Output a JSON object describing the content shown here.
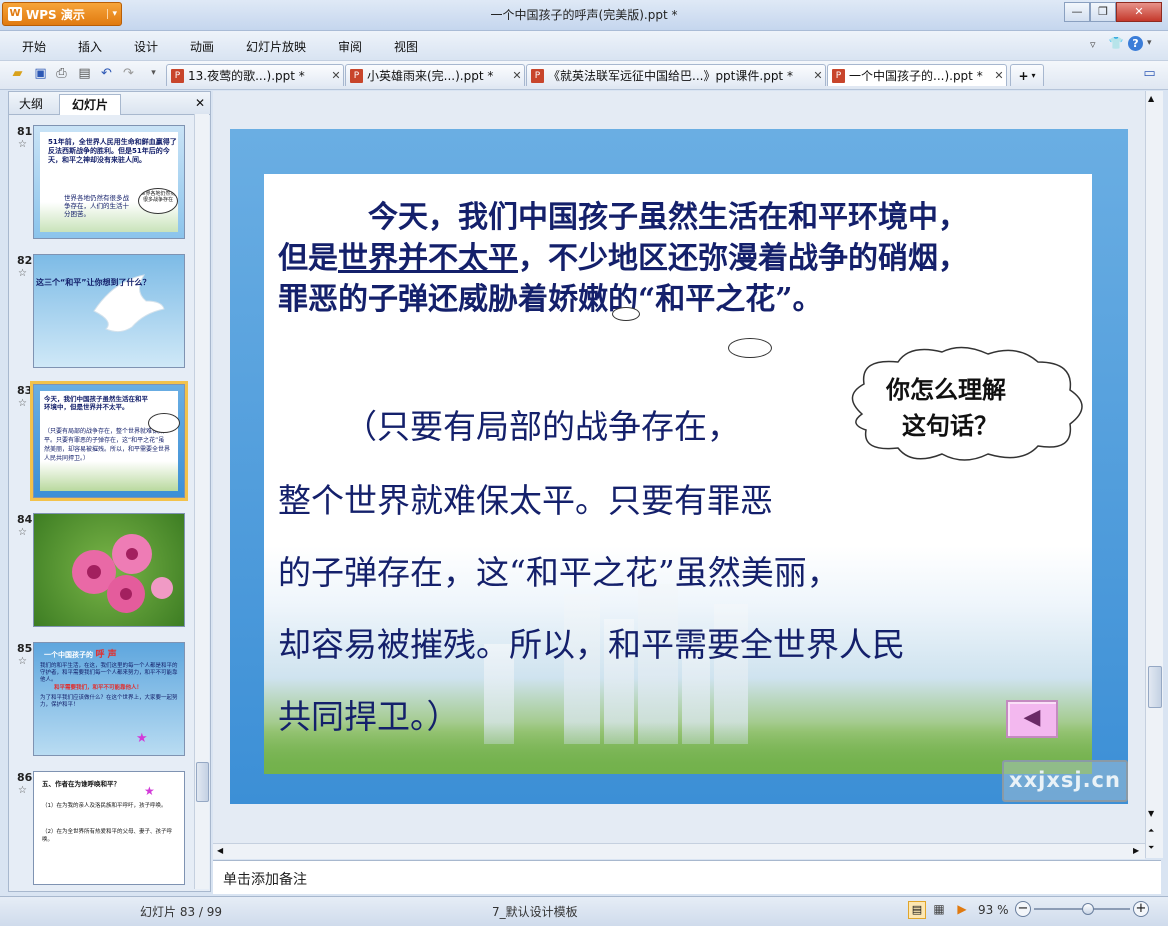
{
  "app": {
    "name": "WPS 演示",
    "caret": "▾",
    "title": "一个中国孩子的呼声(完美版).ppt *"
  },
  "window_controls": {
    "minimize": "—",
    "restore": "❐",
    "close": "✕"
  },
  "menu": [
    "开始",
    "插入",
    "设计",
    "动画",
    "幻灯片放映",
    "审阅",
    "视图"
  ],
  "doc_tabs": [
    {
      "label": "13.夜莺的歌...).ppt *"
    },
    {
      "label": "小英雄雨来(完...).ppt *"
    },
    {
      "label": "《就英法联军远征中国给巴...》ppt课件.ppt *"
    },
    {
      "label": "一个中国孩子的...).ppt *"
    }
  ],
  "tab_close": "✕",
  "tab_add": "+",
  "panel": {
    "tab_outline": "大纲",
    "tab_slides": "幻灯片",
    "close": "✕",
    "star": "☆"
  },
  "slides": [
    {
      "num": "81",
      "text": "51年前，全世界人民用生命和鲜血赢得了反法西斯战争的胜利。但是51年后的今天，和平之神却没有来驻人间。",
      "text2": "世界各地仍然有很多战争存在，人们的生活十分困苦。",
      "bubble": "世界各地仍然有很多战争存在"
    },
    {
      "num": "82",
      "text": "这三个“和平”让你想到了什么？"
    },
    {
      "num": "83",
      "text": "今天，我们中国孩子虽然生活在和平环境中，但是世界并不太平。",
      "text2": "（只要有局部的战争存在，整个世界就难保太平。只要有罪恶的子弹存在，这“和平之花”虽然美丽，却容易被摧残。所以，和平需要全世界人民共同捍卫。）"
    },
    {
      "num": "84"
    },
    {
      "num": "85",
      "title_a": "一个中国孩子的",
      "title_b": "呼 声",
      "text": "我们的和平生活，在这，我们这里的每一个人都是和平的守护者，和平需要我们每一个人都来努力，和平不可能靠他人。",
      "highlight": "和平需要我们，和平不可能靠他人！",
      "text2": "为了和平我们应该做什么？在这个世界上，大家要一起努力，保护和平！"
    },
    {
      "num": "86",
      "text": "五、作者在为谁呼唤和平？",
      "item1": "（1）在为我的亲人及洛民族和平呼吁，孩子呼唤。",
      "item2": "（2）在为全世界所有热爱和平的父母、妻子、孩子呼唤。"
    }
  ],
  "main_slide": {
    "para1_a": "今天，我们中国孩子虽然生活在和平环境中，",
    "para1_b_pre": "但是",
    "para1_b_u": "世界并不太平",
    "para1_b_post": "，不少地区还弥漫着战争的硝烟，",
    "para1_c": "罪恶的子弹还威胁着娇嫩的“和平之花”。",
    "bubble_line1": "你怎么理解",
    "bubble_line2": "这句话？",
    "para2_a": "（只要有局部的战争存在，",
    "para2_b": "整个世界就难保太平。只要有罪恶",
    "para2_c": "的子弹存在，这“和平之花”虽然美丽，",
    "para2_d": "却容易被摧残。所以，和平需要全世界人民",
    "para2_e": "共同捍卫。）",
    "back_arrow": "◀",
    "watermark": "xxjxsj.cn"
  },
  "notes_placeholder": "单击添加备注",
  "status": {
    "slide_info": "幻灯片 83 / 99",
    "template": "7_默认设计模板",
    "zoom": "93 %",
    "zoom_level": 0.55
  }
}
